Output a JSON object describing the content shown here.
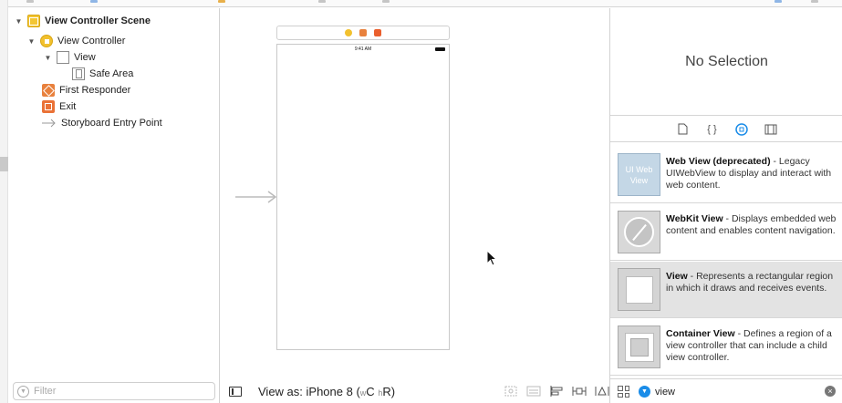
{
  "outline": {
    "items": [
      {
        "label": "View Controller Scene",
        "icon": "scene-icon"
      },
      {
        "label": "View Controller",
        "icon": "view-controller-icon"
      },
      {
        "label": "View",
        "icon": "view-icon"
      },
      {
        "label": "Safe Area",
        "icon": "safe-area-icon"
      },
      {
        "label": "First Responder",
        "icon": "first-responder-icon"
      },
      {
        "label": "Exit",
        "icon": "exit-icon"
      },
      {
        "label": "Storyboard Entry Point",
        "icon": "entry-point-arrow-icon"
      }
    ],
    "filter_placeholder": "Filter"
  },
  "canvas": {
    "status_time": "9:41 AM",
    "view_as_label": "View as: iPhone 8",
    "size_class_w": "w",
    "size_class_c": "C",
    "size_class_h": "h",
    "size_class_r": "R"
  },
  "inspector": {
    "empty_label": "No Selection",
    "library": [
      {
        "title": "Web View (deprecated)",
        "description": " - Legacy UIWebView to display and interact with web content.",
        "thumb_text": "UI Web View"
      },
      {
        "title": "WebKit View",
        "description": " - Displays embedded web content and enables content navigation."
      },
      {
        "title": "View",
        "description": " - Represents a rectangular region in which it draws and receives events."
      },
      {
        "title": "Container View",
        "description": " - Defines a region of a view controller that can include a child view controller."
      }
    ],
    "search_value": "view"
  },
  "colors": {
    "accent": "#1a8ce8",
    "scene_yellow": "#f2c12e",
    "responder_orange": "#e8813d"
  }
}
